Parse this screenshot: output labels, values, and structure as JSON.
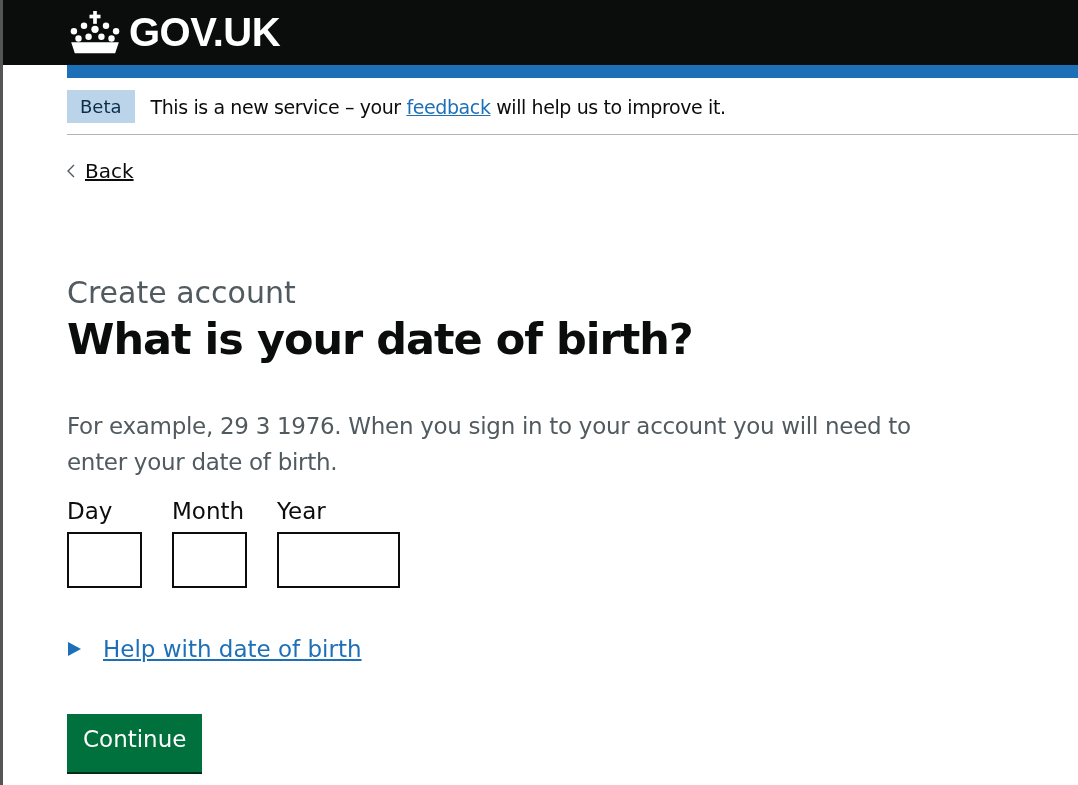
{
  "header": {
    "logo_text": "GOV.UK"
  },
  "phase_banner": {
    "tag": "Beta",
    "text_before": "This is a new service – your ",
    "link": "feedback",
    "text_after": " will help us to improve it."
  },
  "back_link": "Back",
  "caption": "Create account",
  "heading": "What is your date of birth?",
  "hint": "For example, 29 3 1976. When you sign in to your account you will need to enter your date of birth.",
  "date_fields": [
    {
      "label": "Day",
      "kind": "short"
    },
    {
      "label": "Month",
      "kind": "short"
    },
    {
      "label": "Year",
      "kind": "long"
    }
  ],
  "details": {
    "summary": "Help with date of birth",
    "expanded": false
  },
  "button": "Continue"
}
